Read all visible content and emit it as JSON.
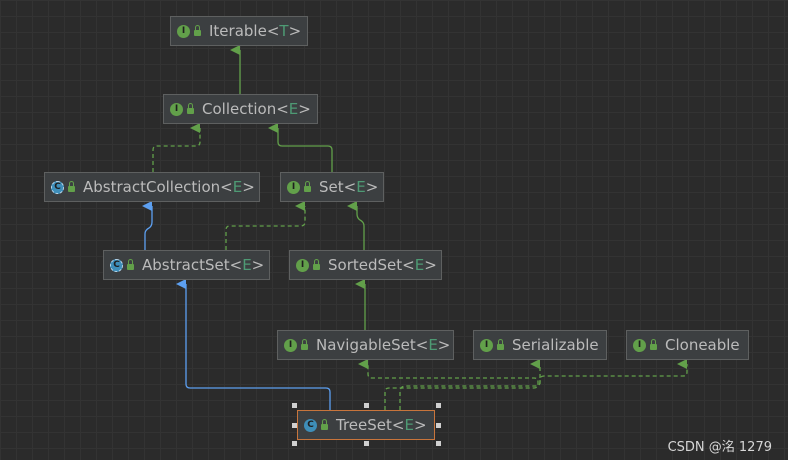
{
  "nodes": {
    "iterable": {
      "kind": "interface",
      "badge": "I",
      "name": "Iterable",
      "type_param": "T"
    },
    "collection": {
      "kind": "interface",
      "badge": "I",
      "name": "Collection",
      "type_param": "E"
    },
    "abstract_collection": {
      "kind": "abstract-class",
      "badge": "C",
      "name": "AbstractCollection",
      "type_param": "E"
    },
    "set": {
      "kind": "interface",
      "badge": "I",
      "name": "Set",
      "type_param": "E"
    },
    "abstract_set": {
      "kind": "abstract-class",
      "badge": "C",
      "name": "AbstractSet",
      "type_param": "E"
    },
    "sorted_set": {
      "kind": "interface",
      "badge": "I",
      "name": "SortedSet",
      "type_param": "E"
    },
    "navigable_set": {
      "kind": "interface",
      "badge": "I",
      "name": "NavigableSet",
      "type_param": "E"
    },
    "serializable": {
      "kind": "interface",
      "badge": "I",
      "name": "Serializable"
    },
    "cloneable": {
      "kind": "interface",
      "badge": "I",
      "name": "Cloneable"
    },
    "tree_set": {
      "kind": "class",
      "badge": "C",
      "name": "TreeSet",
      "type_param": "E",
      "selected": true
    }
  },
  "punct": {
    "lt": "<",
    "gt": ">"
  },
  "edges": [
    {
      "from": "Collection",
      "to": "Iterable",
      "type": "extends"
    },
    {
      "from": "AbstractCollection",
      "to": "Collection",
      "type": "implements"
    },
    {
      "from": "Set",
      "to": "Collection",
      "type": "extends"
    },
    {
      "from": "AbstractSet",
      "to": "AbstractCollection",
      "type": "extends-class"
    },
    {
      "from": "AbstractSet",
      "to": "Set",
      "type": "implements"
    },
    {
      "from": "SortedSet",
      "to": "Set",
      "type": "extends"
    },
    {
      "from": "NavigableSet",
      "to": "SortedSet",
      "type": "extends"
    },
    {
      "from": "TreeSet",
      "to": "AbstractSet",
      "type": "extends-class"
    },
    {
      "from": "TreeSet",
      "to": "NavigableSet",
      "type": "implements"
    },
    {
      "from": "TreeSet",
      "to": "Serializable",
      "type": "implements"
    },
    {
      "from": "TreeSet",
      "to": "Cloneable",
      "type": "implements"
    }
  ],
  "colors": {
    "interface_edge": "#62a04a",
    "class_edge": "#5c9ff0",
    "selection": "#c8753c",
    "background": "#2b2b2b"
  },
  "watermark": "CSDN @洺 1279"
}
